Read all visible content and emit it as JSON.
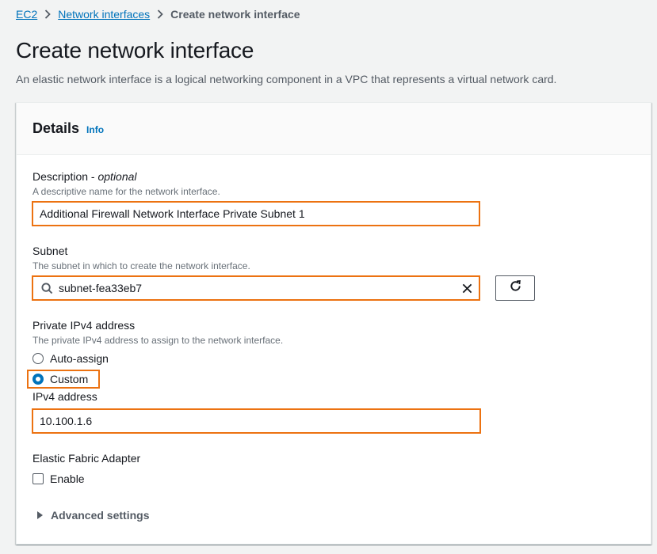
{
  "breadcrumb": {
    "items": [
      "EC2",
      "Network interfaces"
    ],
    "current": "Create network interface"
  },
  "page": {
    "title": "Create network interface",
    "description": "An elastic network interface is a logical networking component in a VPC that represents a virtual network card."
  },
  "details": {
    "title": "Details",
    "info_label": "Info",
    "description_field": {
      "label": "Description",
      "label_suffix_sep": " - ",
      "optional": "optional",
      "hint": "A descriptive name for the network interface.",
      "value": "Additional Firewall Network Interface Private Subnet 1"
    },
    "subnet_field": {
      "label": "Subnet",
      "hint": "The subnet in which to create the network interface.",
      "value": "subnet-fea33eb7"
    },
    "private_ipv4": {
      "label": "Private IPv4 address",
      "hint": "The private IPv4 address to assign to the network interface.",
      "options": [
        "Auto-assign",
        "Custom"
      ],
      "selected": "Custom"
    },
    "ipv4_address": {
      "label": "IPv4 address",
      "value": "10.100.1.6"
    },
    "efa": {
      "label": "Elastic Fabric Adapter",
      "checkbox_label": "Enable",
      "checked": false
    },
    "advanced_settings_label": "Advanced settings"
  },
  "colors": {
    "link": "#0073bb",
    "highlight": "#ec7211",
    "background": "#f2f3f3"
  }
}
